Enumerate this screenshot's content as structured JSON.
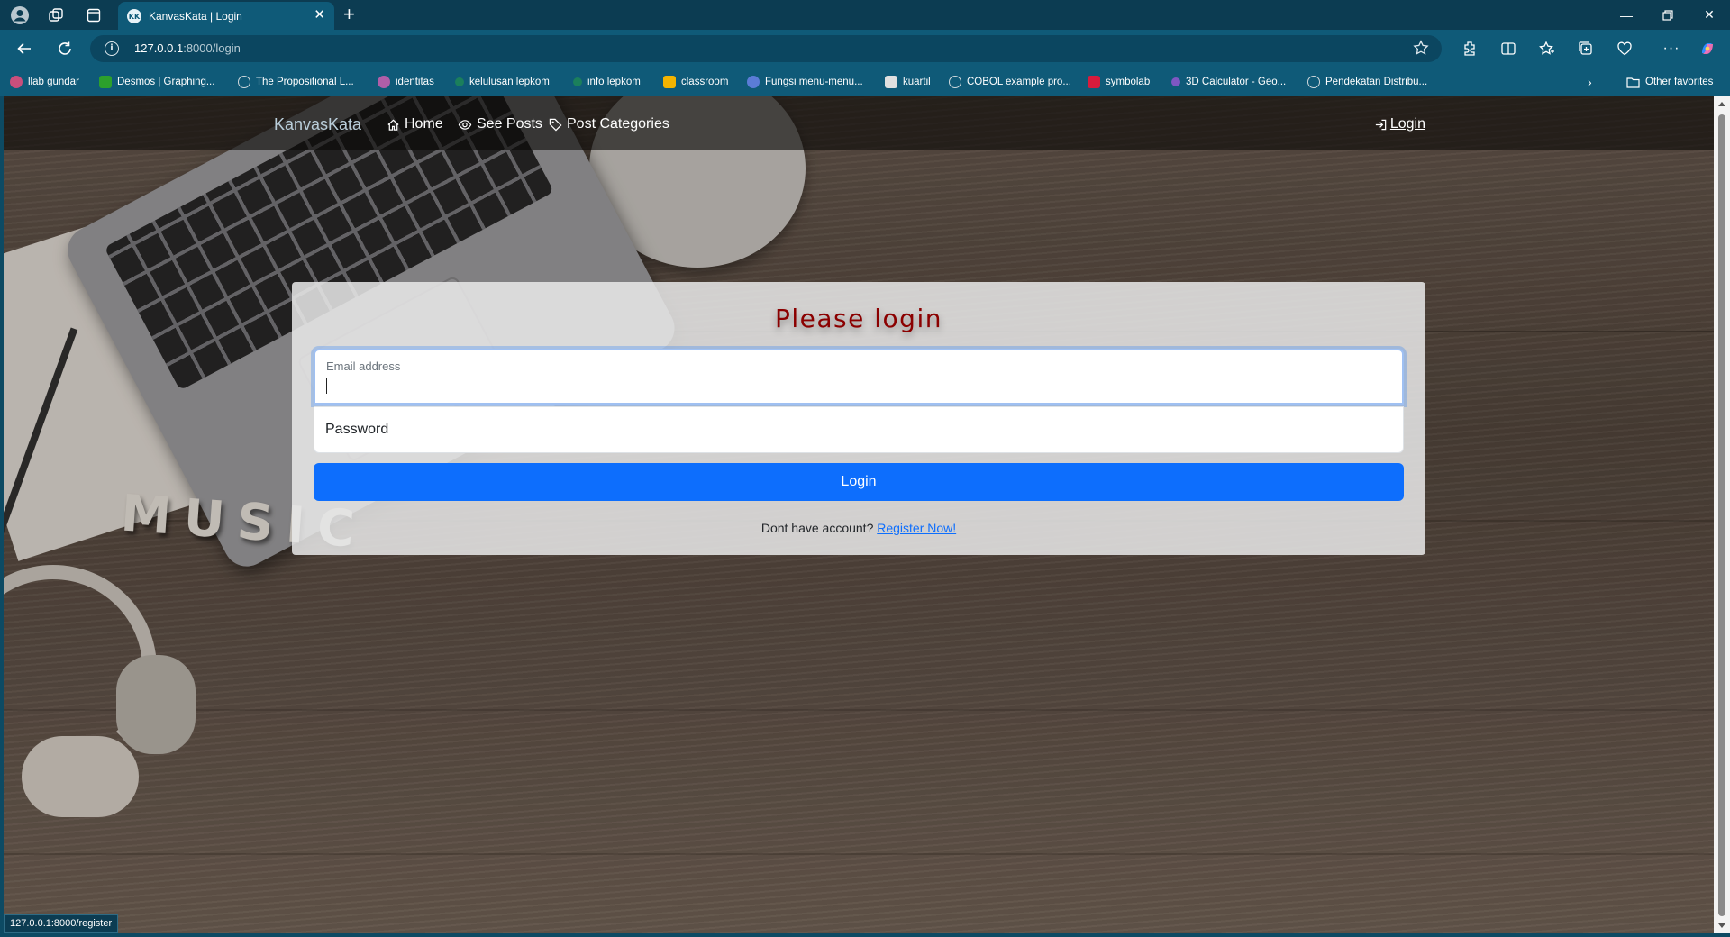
{
  "browser": {
    "tab": {
      "title": "KanvasKata | Login",
      "favicon_text": "KK"
    },
    "address": {
      "host": "127.0.0.1",
      "path": ":8000/login"
    },
    "window_controls": [
      "minimize",
      "restore",
      "close"
    ]
  },
  "bookmarks": [
    {
      "label": "llab gundar",
      "color": "#c94f7c"
    },
    {
      "label": "Desmos | Graphing...",
      "color": "#2ca02c"
    },
    {
      "label": "The Propositional L...",
      "color": "#cfd8dc"
    },
    {
      "label": "identitas",
      "color": "#b05ea8"
    },
    {
      "label": "kelulusan lepkom",
      "color": "#1b7f5c"
    },
    {
      "label": "info lepkom",
      "color": "#1b7f5c"
    },
    {
      "label": "classroom",
      "color": "#f4b400"
    },
    {
      "label": "Fungsi menu-menu...",
      "color": "#5b7cd6"
    },
    {
      "label": "kuartil",
      "color": "#e0e0e0"
    },
    {
      "label": "COBOL example pro...",
      "color": "#cfd8dc"
    },
    {
      "label": "symbolab",
      "color": "#d81b3c"
    },
    {
      "label": "3D Calculator - Geo...",
      "color": "#7e57c2"
    },
    {
      "label": "Pendekatan Distribu...",
      "color": "#cfd8dc"
    },
    {
      "label": "Other favorites",
      "color": "#0f5a78"
    }
  ],
  "site": {
    "brand": "KanvasKata",
    "nav": [
      {
        "label": "Home",
        "icon": "house-icon"
      },
      {
        "label": "See Posts",
        "icon": "eye-icon"
      },
      {
        "label": "Post Categories",
        "icon": "tag-icon"
      }
    ],
    "login_link": "Login",
    "background_word": "MUSIC"
  },
  "login_form": {
    "title": "Please login",
    "email_label": "Email address",
    "email_value": "",
    "password_label": "Password",
    "submit_label": "Login",
    "register_prompt": "Dont have account?",
    "register_link": "Register Now!"
  },
  "status_bar": {
    "url": "127.0.0.1:8000/register"
  },
  "colors": {
    "primary": "#0d6efd",
    "title": "#8b0000",
    "brand": "#b9cdd9",
    "chrome_dark": "#0c3c52",
    "chrome": "#0f5a78"
  }
}
